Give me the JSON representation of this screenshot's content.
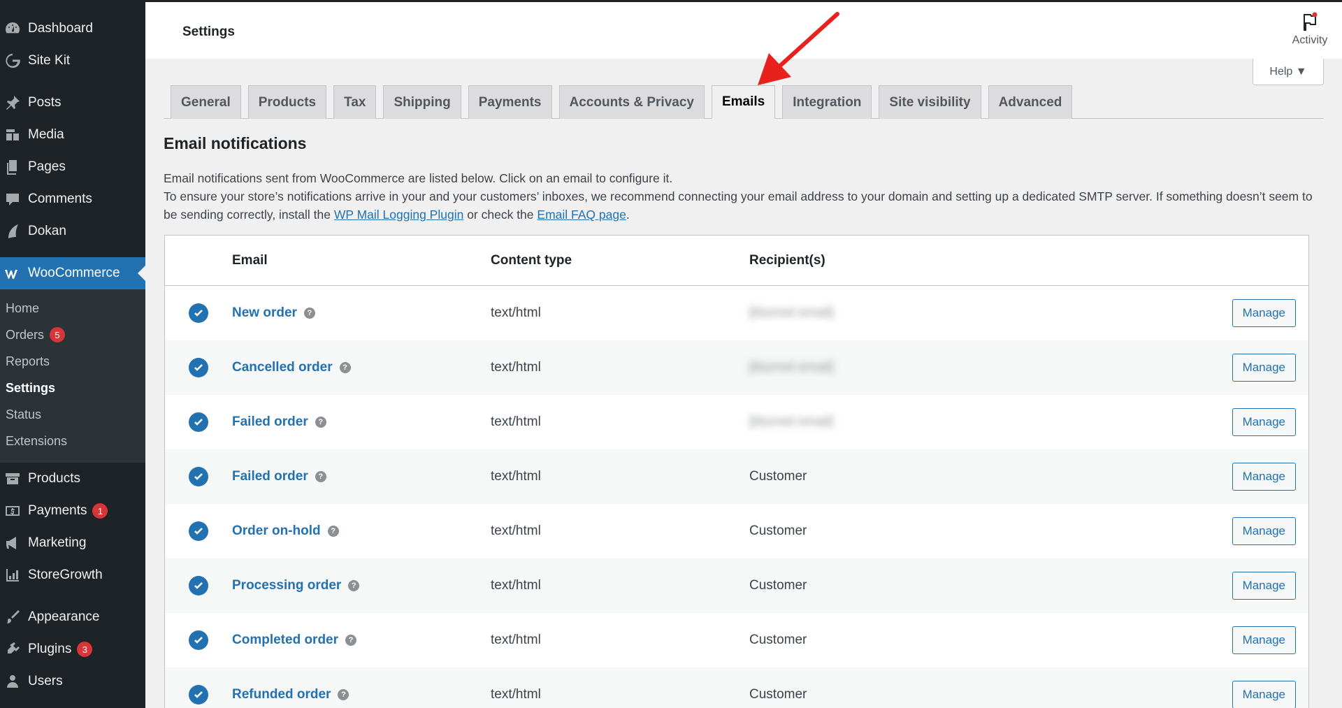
{
  "sidebar": {
    "top": [
      {
        "label": "Dashboard",
        "icon": "dashboard-icon"
      },
      {
        "label": "Site Kit",
        "icon": "google-g-icon"
      }
    ],
    "main": [
      {
        "label": "Posts",
        "icon": "pin-icon"
      },
      {
        "label": "Media",
        "icon": "media-icon"
      },
      {
        "label": "Pages",
        "icon": "pages-icon"
      },
      {
        "label": "Comments",
        "icon": "comment-icon"
      },
      {
        "label": "Dokan",
        "icon": "dokan-icon"
      }
    ],
    "woocommerce": {
      "label": "WooCommerce",
      "icon": "woocommerce-icon"
    },
    "submenu": [
      {
        "label": "Home"
      },
      {
        "label": "Orders",
        "badge": "5"
      },
      {
        "label": "Reports"
      },
      {
        "label": "Settings"
      },
      {
        "label": "Status"
      },
      {
        "label": "Extensions"
      }
    ],
    "bottom": [
      {
        "label": "Products",
        "icon": "archive-icon"
      },
      {
        "label": "Payments",
        "icon": "payments-icon",
        "badge": "1"
      },
      {
        "label": "Marketing",
        "icon": "megaphone-icon"
      },
      {
        "label": "StoreGrowth",
        "icon": "chart-icon"
      }
    ],
    "bottom2": [
      {
        "label": "Appearance",
        "icon": "brush-icon"
      },
      {
        "label": "Plugins",
        "icon": "plugin-icon",
        "badge": "3"
      },
      {
        "label": "Users",
        "icon": "user-icon"
      }
    ]
  },
  "header": {
    "title": "Settings",
    "activity_label": "Activity",
    "help_label": "Help ▼"
  },
  "tabs": [
    "General",
    "Products",
    "Tax",
    "Shipping",
    "Payments",
    "Accounts & Privacy",
    "Emails",
    "Integration",
    "Site visibility",
    "Advanced"
  ],
  "active_tab": "Emails",
  "content": {
    "title": "Email notifications",
    "desc1": "Email notifications sent from WooCommerce are listed below. Click on an email to configure it.",
    "desc2": "To ensure your store’s notifications arrive in your and your customers’ inboxes, we recommend connecting your email address to your domain and setting up a dedicated SMTP server. If something doesn’t seem to be sending correctly, install the ",
    "link1": "WP Mail Logging Plugin",
    "desc3": " or check the ",
    "link2": "Email FAQ page",
    "desc4": "."
  },
  "table": {
    "headers": {
      "email": "Email",
      "type": "Content type",
      "recipients": "Recipient(s)"
    },
    "manage_label": "Manage",
    "rows": [
      {
        "name": "New order",
        "type": "text/html",
        "recipient": "[blurred email]"
      },
      {
        "name": "Cancelled order",
        "type": "text/html",
        "recipient": "[blurred email]"
      },
      {
        "name": "Failed order",
        "type": "text/html",
        "recipient": "[blurred email]"
      },
      {
        "name": "Failed order",
        "type": "text/html",
        "recipient": "Customer"
      },
      {
        "name": "Order on-hold",
        "type": "text/html",
        "recipient": "Customer"
      },
      {
        "name": "Processing order",
        "type": "text/html",
        "recipient": "Customer"
      },
      {
        "name": "Completed order",
        "type": "text/html",
        "recipient": "Customer"
      },
      {
        "name": "Refunded order",
        "type": "text/html",
        "recipient": "Customer"
      }
    ]
  },
  "colors": {
    "accent": "#2271b1",
    "sidebar": "#1d2327",
    "badge": "#d63638",
    "arrow": "#e8211c"
  }
}
